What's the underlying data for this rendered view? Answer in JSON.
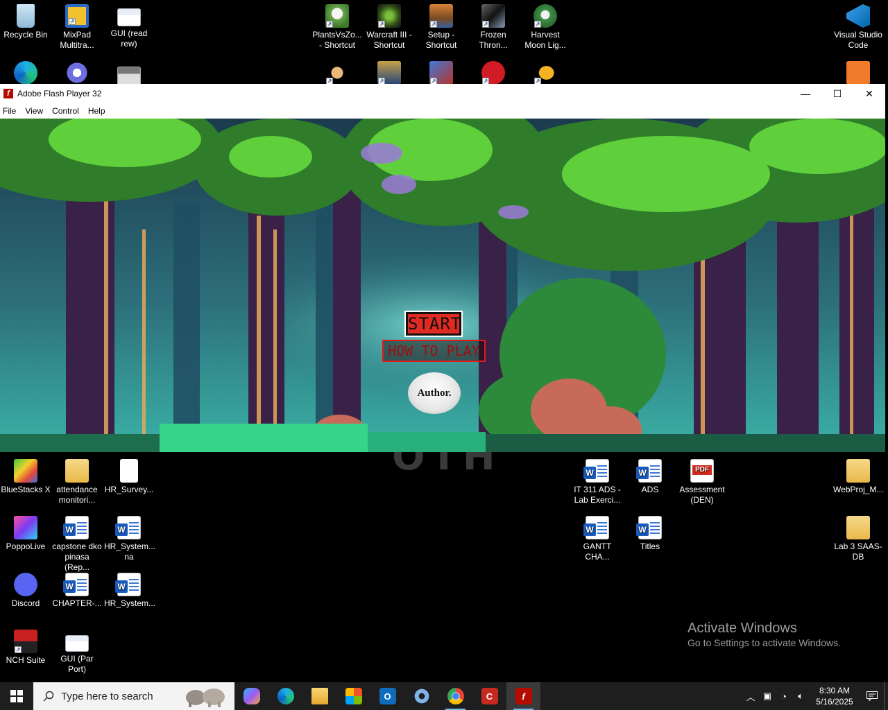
{
  "desktop": {
    "icons_top": [
      {
        "id": "recycle-bin",
        "label": "Recycle Bin",
        "icon": "recycle-bin-icon"
      },
      {
        "id": "mixpad",
        "label": "MixPad Multitra...",
        "icon": "mixpad-icon"
      },
      {
        "id": "gui-readrew",
        "label": "GUI (read rew)",
        "icon": "gui-document-icon"
      },
      {
        "id": "pvz",
        "label": "PlantsVsZo... - Shortcut",
        "icon": "plants-vs-zombies-icon"
      },
      {
        "id": "warcraft",
        "label": "Warcraft III - Shortcut",
        "icon": "warcraft-icon"
      },
      {
        "id": "setup",
        "label": "Setup - Shortcut",
        "icon": "setup-icon"
      },
      {
        "id": "frozen",
        "label": "Frozen Thron...",
        "icon": "frozen-throne-icon"
      },
      {
        "id": "harvest",
        "label": "Harvest Moon Lig...",
        "icon": "harvest-moon-icon"
      },
      {
        "id": "vscode",
        "label": "Visual Studio Code",
        "icon": "vscode-icon"
      }
    ],
    "icons_bottom": [
      {
        "id": "bluestacks",
        "label": "BlueStacks X",
        "icon": "bluestacks-icon"
      },
      {
        "id": "attendance",
        "label": "attendance monitori...",
        "icon": "folder-zip-icon"
      },
      {
        "id": "hr-survey",
        "label": "HR_Survey...",
        "icon": "blank-file-icon"
      },
      {
        "id": "poppolive",
        "label": "PoppoLive",
        "icon": "poppolive-icon"
      },
      {
        "id": "capstone",
        "label": "capstone dko pinasa (Rep...",
        "icon": "word-document-icon"
      },
      {
        "id": "hr-system-na",
        "label": "HR_System... na",
        "icon": "word-document-icon"
      },
      {
        "id": "discord",
        "label": "Discord",
        "icon": "discord-icon"
      },
      {
        "id": "chapter",
        "label": "CHAPTER-...",
        "icon": "word-document-icon"
      },
      {
        "id": "hr-system",
        "label": "HR_System...",
        "icon": "word-document-icon"
      },
      {
        "id": "nch",
        "label": "NCH Suite",
        "icon": "nch-suite-icon"
      },
      {
        "id": "gui-parport",
        "label": "GUI (Par Port)",
        "icon": "gui-document-icon"
      },
      {
        "id": "it311",
        "label": "IT 311 ADS - Lab Exerci...",
        "icon": "word-document-icon"
      },
      {
        "id": "ads",
        "label": "ADS",
        "icon": "word-document-icon"
      },
      {
        "id": "assessment",
        "label": "Assessment (DEN)",
        "icon": "pdf-icon"
      },
      {
        "id": "webproj",
        "label": "WebProj_M...",
        "icon": "folder-zip-icon"
      },
      {
        "id": "gantt",
        "label": "GANTT CHA...",
        "icon": "word-document-icon"
      },
      {
        "id": "titles",
        "label": "Titles",
        "icon": "word-document-icon"
      },
      {
        "id": "lab3",
        "label": "Lab 3 SAAS-DB",
        "icon": "folder-zip-icon"
      }
    ],
    "activate": {
      "heading": "Activate Windows",
      "sub": "Go to Settings to activate Windows."
    },
    "behind_window_text": "OTH"
  },
  "flash_window": {
    "title": "Adobe Flash Player 32",
    "controls": {
      "minimize": "—",
      "maximize": "☐",
      "close": "✕"
    },
    "menu": [
      "File",
      "View",
      "Control",
      "Help"
    ],
    "game": {
      "start_label": "START",
      "howto_label": "HOW TO PLAY",
      "author_label": "Author."
    }
  },
  "taskbar": {
    "search_placeholder": "Type here to search",
    "pinned": [
      {
        "id": "copilot",
        "icon": "copilot-icon"
      },
      {
        "id": "edge",
        "icon": "edge-icon"
      },
      {
        "id": "explorer",
        "icon": "file-explorer-icon"
      },
      {
        "id": "store",
        "icon": "microsoft-store-icon"
      },
      {
        "id": "outlook",
        "icon": "outlook-icon"
      },
      {
        "id": "settings-app",
        "icon": "app-gear-icon"
      },
      {
        "id": "chrome",
        "icon": "chrome-icon"
      },
      {
        "id": "ccleaner",
        "icon": "ccleaner-icon"
      },
      {
        "id": "flash",
        "icon": "flash-player-icon"
      }
    ],
    "clock": {
      "time": "8:30 AM",
      "date": "5/16/2025"
    }
  }
}
